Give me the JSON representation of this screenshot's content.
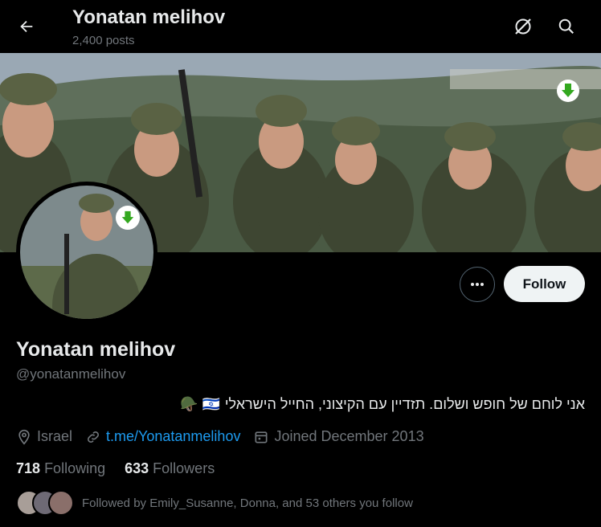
{
  "header": {
    "title": "Yonatan melihov",
    "posts": "2,400 posts"
  },
  "icons": {
    "back": "back-arrow-icon",
    "grok": "grok-icon",
    "search": "search-icon",
    "more": "more-icon",
    "download": "download-arrow-icon"
  },
  "profile": {
    "name": "Yonatan melihov",
    "handle": "@yonatanmelihov",
    "bio": "אני לוחם של חופש ושלום.  תזדיין עם הקיצוני, החייל הישראלי",
    "bio_emoji": "🪖 🇮🇱",
    "location": "Israel",
    "link": "t.me/Yonatanmelihov",
    "joined": "Joined December 2013",
    "following_count": "718",
    "following_label": "Following",
    "followers_count": "633",
    "followers_label": "Followers",
    "followed_by": "Followed by Emily_Susanne, Donna, and 53 others you follow"
  },
  "actions": {
    "follow": "Follow"
  },
  "colors": {
    "accent": "#1d9bf0",
    "download_badge": "#33a81f"
  }
}
